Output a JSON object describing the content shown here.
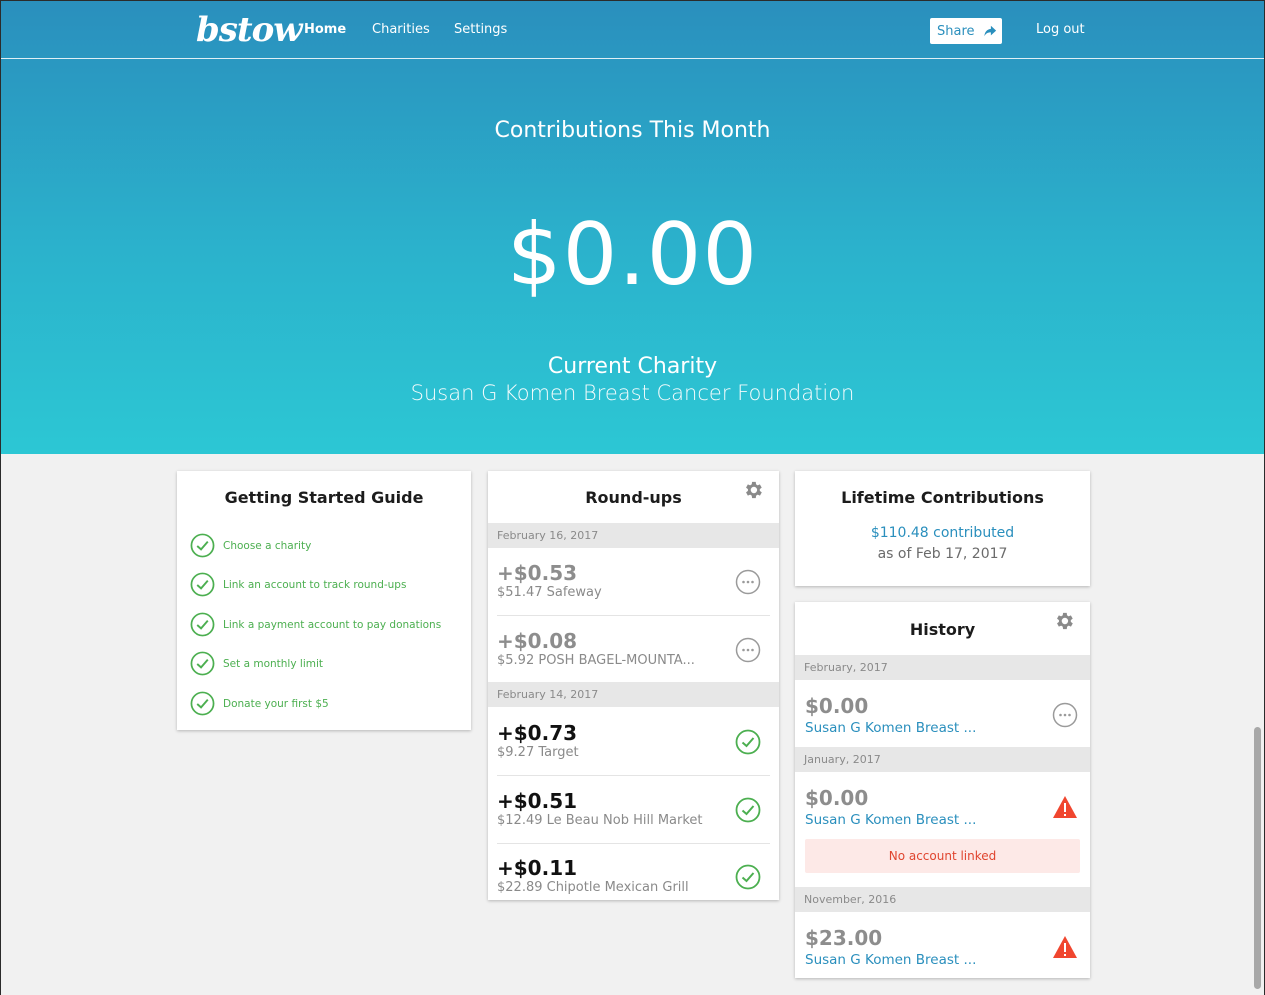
{
  "app": {
    "logo": "bstow"
  },
  "nav": {
    "home": "Home",
    "charities": "Charities",
    "settings": "Settings",
    "share": "Share",
    "logout": "Log out"
  },
  "hero": {
    "title": "Contributions This Month",
    "amount": "$0.00",
    "charity_label": "Current Charity",
    "charity_name": "Susan G Komen Breast Cancer Foundation"
  },
  "guide": {
    "title": "Getting Started Guide",
    "items": [
      "Choose a charity",
      "Link an account to track round-ups",
      "Link a payment account to pay donations",
      "Set a monthly limit",
      "Donate your first $5"
    ]
  },
  "roundups": {
    "title": "Round-ups",
    "groups": [
      {
        "date": "February 16, 2017",
        "items": [
          {
            "amount": "+$0.53",
            "desc": "$51.47 Safeway",
            "status": "pending"
          },
          {
            "amount": "+$0.08",
            "desc": "$5.92 POSH BAGEL-MOUNTA...",
            "status": "pending"
          }
        ]
      },
      {
        "date": "February 14, 2017",
        "items": [
          {
            "amount": "+$0.73",
            "desc": "$9.27 Target",
            "status": "done"
          },
          {
            "amount": "+$0.51",
            "desc": "$12.49 Le Beau Nob Hill Market",
            "status": "done"
          },
          {
            "amount": "+$0.11",
            "desc": "$22.89 Chipotle Mexican Grill",
            "status": "done"
          }
        ]
      }
    ]
  },
  "lifetime": {
    "title": "Lifetime Contributions",
    "amount": "$110.48 contributed",
    "as_of": "as of Feb 17, 2017"
  },
  "history": {
    "title": "History",
    "months": [
      {
        "month": "February, 2017",
        "amount": "$0.00",
        "charity": "Susan G Komen Breast ...",
        "status": "pending"
      },
      {
        "month": "January, 2017",
        "amount": "$0.00",
        "charity": "Susan G Komen Breast ...",
        "status": "warning",
        "warning": "No account linked"
      },
      {
        "month": "November, 2016",
        "amount": "$23.00",
        "charity": "Susan G Komen Breast ...",
        "status": "warning"
      }
    ]
  },
  "colors": {
    "primary": "#2a8fbd",
    "accent": "#2cc7d4",
    "success": "#4caf50",
    "danger": "#f0462f"
  }
}
